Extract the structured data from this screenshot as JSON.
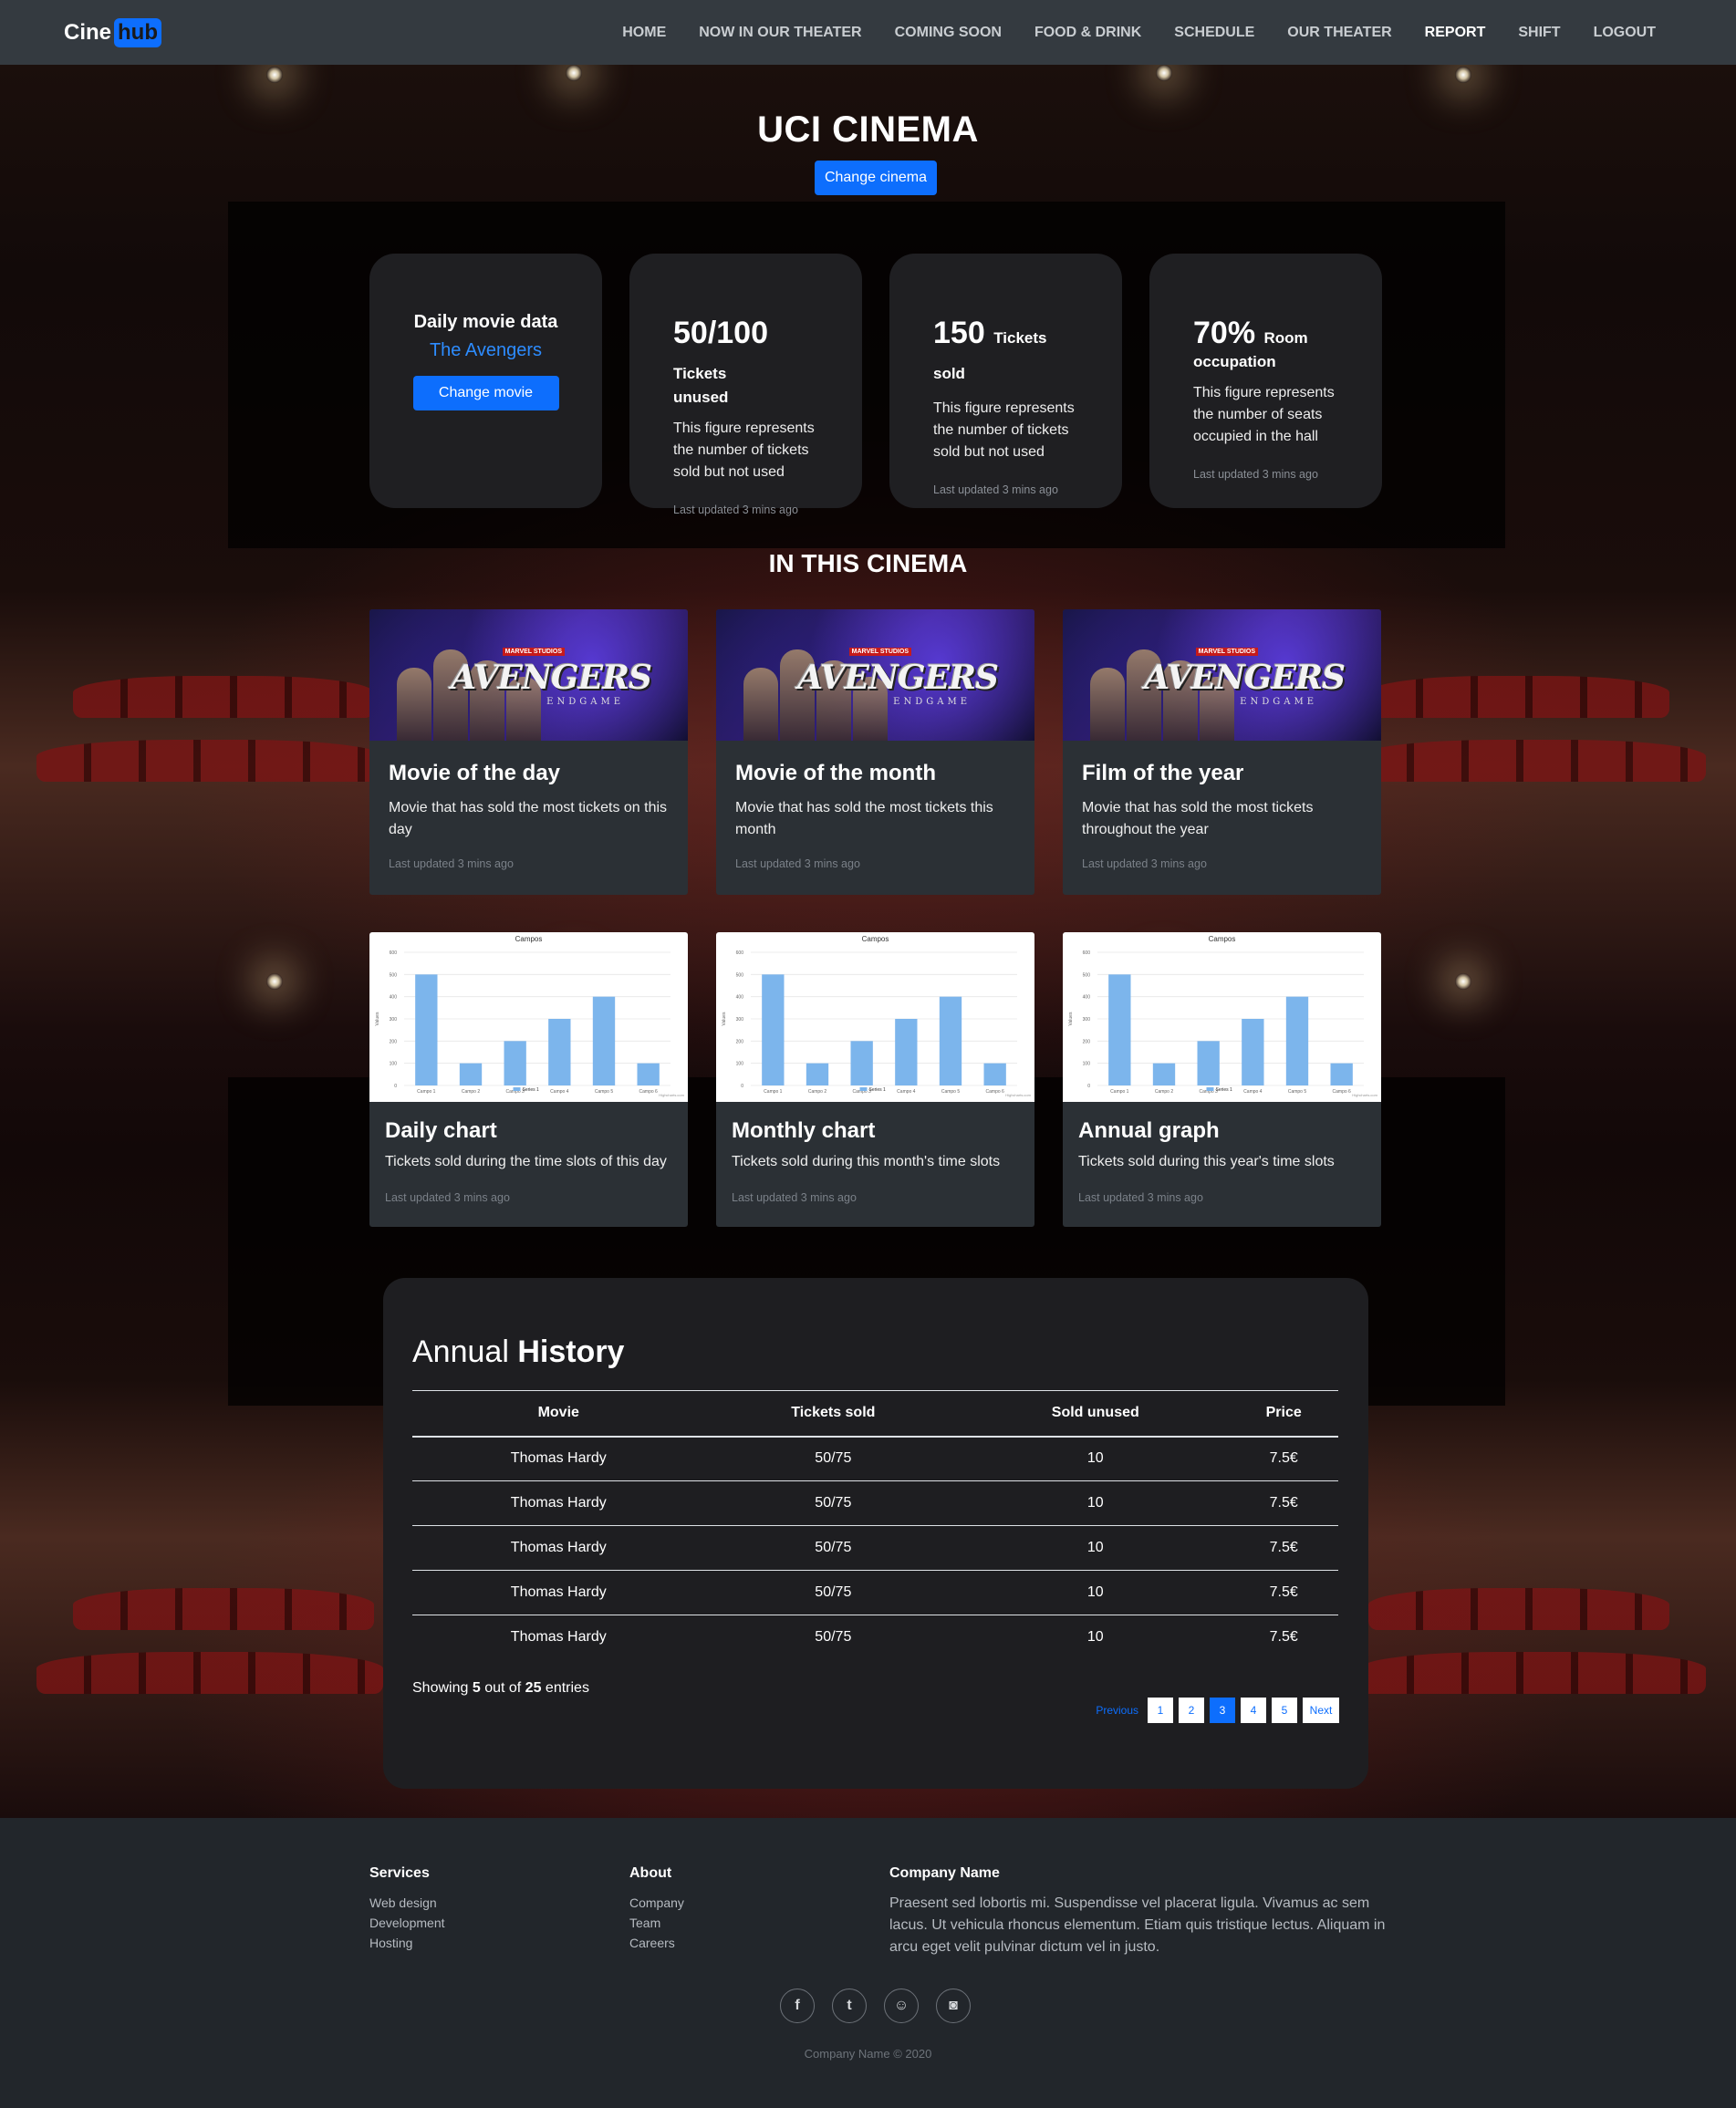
{
  "brand": {
    "cine": "Cine",
    "hub": "hub"
  },
  "nav": {
    "items": [
      {
        "label": "HOME",
        "active": false
      },
      {
        "label": "NOW IN OUR THEATER",
        "active": false
      },
      {
        "label": "COMING SOON",
        "active": false
      },
      {
        "label": "FOOD & DRINK",
        "active": false
      },
      {
        "label": "SCHEDULE",
        "active": false
      },
      {
        "label": "OUR THEATER",
        "active": false
      },
      {
        "label": "REPORT",
        "active": true
      },
      {
        "label": "SHIFT",
        "active": false
      },
      {
        "label": "LOGOUT",
        "active": false
      }
    ]
  },
  "hero": {
    "title": "UCI CINEMA",
    "change_cinema": "Change cinema"
  },
  "stats": {
    "movie": {
      "label": "Daily movie data",
      "name": "The Avengers",
      "button": "Change movie"
    },
    "unused": {
      "value": "50/100",
      "unit": "Tickets",
      "unit2": "unused",
      "desc": "This figure represents the number of tickets sold but not used",
      "updated": "Last updated 3 mins ago"
    },
    "sold": {
      "value": "150",
      "unit": "Tickets sold",
      "desc": "This figure represents the number of tickets sold but not used",
      "updated": "Last updated 3 mins ago"
    },
    "occupation": {
      "value": "70%",
      "unit": "Room",
      "unit2": "occupation",
      "desc": "This figure represents the number of seats occupied in the hall",
      "updated": "Last updated 3 mins ago"
    }
  },
  "section_title": "IN THIS CINEMA",
  "poster_text": {
    "logo": "AVENGERS",
    "sub": "ENDGAME",
    "top": "MARVEL STUDIOS"
  },
  "top_movies": [
    {
      "title": "Movie of the day",
      "desc": "Movie that has sold the most tickets on this day",
      "updated": "Last updated 3 mins ago"
    },
    {
      "title": "Movie of the month",
      "desc": "Movie that has sold the most tickets this month",
      "updated": "Last updated 3 mins ago"
    },
    {
      "title": "Film of the year",
      "desc": "Movie that has sold the most tickets throughout the year",
      "updated": "Last updated 3 mins ago"
    }
  ],
  "charts": [
    {
      "title": "Daily chart",
      "desc": "Tickets sold during the time slots of this day",
      "updated": "Last updated 3 mins ago"
    },
    {
      "title": "Monthly chart",
      "desc": "Tickets sold during this month's time slots",
      "updated": "Last updated 3 mins ago"
    },
    {
      "title": "Annual graph",
      "desc": "Tickets sold during this year's time slots",
      "updated": "Last updated 3 mins ago"
    }
  ],
  "chart_data": [
    {
      "type": "bar",
      "title": "Campos",
      "categories": [
        "Campo 1",
        "Campo 2",
        "Campo 3",
        "Campo 4",
        "Campo 5",
        "Campo 6"
      ],
      "series": [
        {
          "name": "Series 1",
          "values": [
            500,
            100,
            200,
            300,
            400,
            100
          ]
        }
      ],
      "ylim": [
        0,
        600
      ],
      "yticks": [
        0,
        100,
        200,
        300,
        400,
        500,
        600
      ],
      "ylabel": "Values",
      "credit": "Highcharts.com",
      "color": "#7cb5ec"
    },
    {
      "type": "bar",
      "title": "Campos",
      "categories": [
        "Campo 1",
        "Campo 2",
        "Campo 3",
        "Campo 4",
        "Campo 5",
        "Campo 6"
      ],
      "series": [
        {
          "name": "Series 1",
          "values": [
            500,
            100,
            200,
            300,
            400,
            100
          ]
        }
      ],
      "ylim": [
        0,
        600
      ],
      "yticks": [
        0,
        100,
        200,
        300,
        400,
        500,
        600
      ],
      "ylabel": "Values",
      "credit": "Highcharts.com",
      "color": "#7cb5ec"
    },
    {
      "type": "bar",
      "title": "Campos",
      "categories": [
        "Campo 1",
        "Campo 2",
        "Campo 3",
        "Campo 4",
        "Campo 5",
        "Campo 6"
      ],
      "series": [
        {
          "name": "Series 1",
          "values": [
            500,
            100,
            200,
            300,
            400,
            100
          ]
        }
      ],
      "ylim": [
        0,
        600
      ],
      "yticks": [
        0,
        100,
        200,
        300,
        400,
        500,
        600
      ],
      "ylabel": "Values",
      "credit": "Highcharts.com",
      "color": "#7cb5ec"
    }
  ],
  "history": {
    "title_light": "Annual",
    "title_bold": "History",
    "columns": [
      "Movie",
      "Tickets sold",
      "Sold unused",
      "Price"
    ],
    "rows": [
      [
        "Thomas Hardy",
        "50/75",
        "10",
        "7.5€"
      ],
      [
        "Thomas Hardy",
        "50/75",
        "10",
        "7.5€"
      ],
      [
        "Thomas Hardy",
        "50/75",
        "10",
        "7.5€"
      ],
      [
        "Thomas Hardy",
        "50/75",
        "10",
        "7.5€"
      ],
      [
        "Thomas Hardy",
        "50/75",
        "10",
        "7.5€"
      ]
    ],
    "showing_prefix": "Showing",
    "showing_count": "5",
    "showing_mid": "out of",
    "showing_total": "25",
    "showing_suffix": "entries",
    "pagination": {
      "previous": "Previous",
      "pages": [
        "1",
        "2",
        "3",
        "4",
        "5"
      ],
      "active": "3",
      "next": "Next"
    }
  },
  "footer": {
    "services": {
      "title": "Services",
      "links": [
        "Web design",
        "Development",
        "Hosting"
      ]
    },
    "about": {
      "title": "About",
      "links": [
        "Company",
        "Team",
        "Careers"
      ]
    },
    "company": {
      "title": "Company Name",
      "text": "Praesent sed lobortis mi. Suspendisse vel placerat ligula. Vivamus ac sem lacus. Ut vehicula rhoncus elementum. Etiam quis tristique lectus. Aliquam in arcu eget velit pulvinar dictum vel in justo."
    },
    "socials": [
      {
        "icon": "facebook-icon",
        "glyph": "f"
      },
      {
        "icon": "twitter-icon",
        "glyph": "t"
      },
      {
        "icon": "snapchat-icon",
        "glyph": "☺"
      },
      {
        "icon": "instagram-icon",
        "glyph": "◙"
      }
    ],
    "copyright": "Company Name © 2020"
  },
  "colors": {
    "accent": "#0d6efd",
    "nav_bg": "#343a40",
    "card_bg": "#2b3035",
    "footer_bg": "#22262b"
  }
}
